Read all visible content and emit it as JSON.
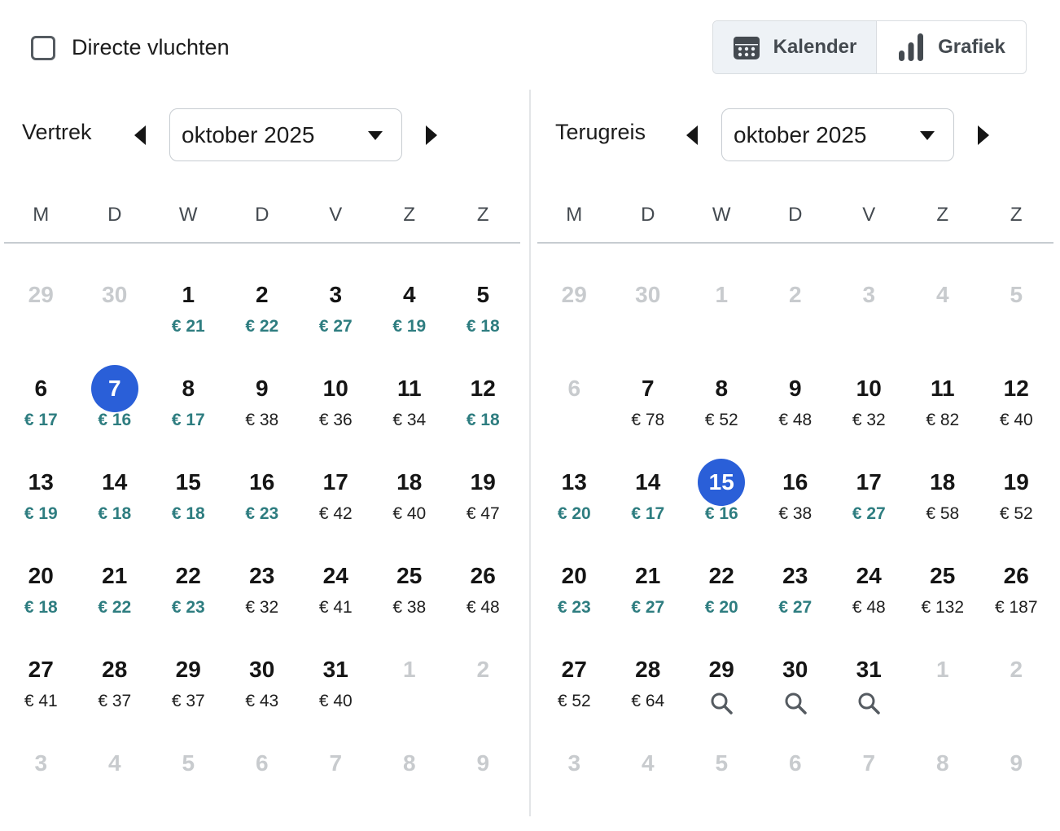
{
  "topbar": {
    "direct_label": "Directe vluchten",
    "view_toggle": {
      "calendar": "Kalender",
      "chart": "Grafiek"
    }
  },
  "weekdays": [
    "M",
    "D",
    "W",
    "D",
    "V",
    "Z",
    "Z"
  ],
  "colors": {
    "selected": "#2a5fd8",
    "cheap_price": "#2e7d80",
    "muted_day": "#c8cbce"
  },
  "panels": {
    "departure": {
      "label": "Vertrek",
      "month": "oktober 2025",
      "days": [
        {
          "d": "29",
          "muted": true
        },
        {
          "d": "30",
          "muted": true
        },
        {
          "d": "1",
          "p": "€ 21",
          "cheap": true
        },
        {
          "d": "2",
          "p": "€ 22",
          "cheap": true
        },
        {
          "d": "3",
          "p": "€ 27",
          "cheap": true
        },
        {
          "d": "4",
          "p": "€ 19",
          "cheap": true
        },
        {
          "d": "5",
          "p": "€ 18",
          "cheap": true
        },
        {
          "d": "6",
          "p": "€ 17",
          "cheap": true
        },
        {
          "d": "7",
          "p": "€ 16",
          "cheap": true,
          "selected": true
        },
        {
          "d": "8",
          "p": "€ 17",
          "cheap": true
        },
        {
          "d": "9",
          "p": "€ 38"
        },
        {
          "d": "10",
          "p": "€ 36"
        },
        {
          "d": "11",
          "p": "€ 34"
        },
        {
          "d": "12",
          "p": "€ 18",
          "cheap": true
        },
        {
          "d": "13",
          "p": "€ 19",
          "cheap": true
        },
        {
          "d": "14",
          "p": "€ 18",
          "cheap": true
        },
        {
          "d": "15",
          "p": "€ 18",
          "cheap": true
        },
        {
          "d": "16",
          "p": "€ 23",
          "cheap": true
        },
        {
          "d": "17",
          "p": "€ 42"
        },
        {
          "d": "18",
          "p": "€ 40"
        },
        {
          "d": "19",
          "p": "€ 47"
        },
        {
          "d": "20",
          "p": "€ 18",
          "cheap": true
        },
        {
          "d": "21",
          "p": "€ 22",
          "cheap": true
        },
        {
          "d": "22",
          "p": "€ 23",
          "cheap": true
        },
        {
          "d": "23",
          "p": "€ 32"
        },
        {
          "d": "24",
          "p": "€ 41"
        },
        {
          "d": "25",
          "p": "€ 38"
        },
        {
          "d": "26",
          "p": "€ 48"
        },
        {
          "d": "27",
          "p": "€ 41"
        },
        {
          "d": "28",
          "p": "€ 37"
        },
        {
          "d": "29",
          "p": "€ 37"
        },
        {
          "d": "30",
          "p": "€ 43"
        },
        {
          "d": "31",
          "p": "€ 40"
        },
        {
          "d": "1",
          "muted": true
        },
        {
          "d": "2",
          "muted": true
        },
        {
          "d": "3",
          "muted": true
        },
        {
          "d": "4",
          "muted": true
        },
        {
          "d": "5",
          "muted": true
        },
        {
          "d": "6",
          "muted": true
        },
        {
          "d": "7",
          "muted": true
        },
        {
          "d": "8",
          "muted": true
        },
        {
          "d": "9",
          "muted": true
        }
      ]
    },
    "return": {
      "label": "Terugreis",
      "month": "oktober 2025",
      "days": [
        {
          "d": "29",
          "muted": true
        },
        {
          "d": "30",
          "muted": true
        },
        {
          "d": "1",
          "muted": true
        },
        {
          "d": "2",
          "muted": true
        },
        {
          "d": "3",
          "muted": true
        },
        {
          "d": "4",
          "muted": true
        },
        {
          "d": "5",
          "muted": true
        },
        {
          "d": "6",
          "muted": true
        },
        {
          "d": "7",
          "p": "€ 78"
        },
        {
          "d": "8",
          "p": "€ 52"
        },
        {
          "d": "9",
          "p": "€ 48"
        },
        {
          "d": "10",
          "p": "€ 32"
        },
        {
          "d": "11",
          "p": "€ 82"
        },
        {
          "d": "12",
          "p": "€ 40"
        },
        {
          "d": "13",
          "p": "€ 20",
          "cheap": true
        },
        {
          "d": "14",
          "p": "€ 17",
          "cheap": true
        },
        {
          "d": "15",
          "p": "€ 16",
          "cheap": true,
          "selected": true
        },
        {
          "d": "16",
          "p": "€ 38"
        },
        {
          "d": "17",
          "p": "€ 27",
          "cheap": true
        },
        {
          "d": "18",
          "p": "€ 58"
        },
        {
          "d": "19",
          "p": "€ 52"
        },
        {
          "d": "20",
          "p": "€ 23",
          "cheap": true
        },
        {
          "d": "21",
          "p": "€ 27",
          "cheap": true
        },
        {
          "d": "22",
          "p": "€ 20",
          "cheap": true
        },
        {
          "d": "23",
          "p": "€ 27",
          "cheap": true
        },
        {
          "d": "24",
          "p": "€ 48"
        },
        {
          "d": "25",
          "p": "€ 132"
        },
        {
          "d": "26",
          "p": "€ 187"
        },
        {
          "d": "27",
          "p": "€ 52"
        },
        {
          "d": "28",
          "p": "€ 64"
        },
        {
          "d": "29",
          "search": true
        },
        {
          "d": "30",
          "search": true
        },
        {
          "d": "31",
          "search": true
        },
        {
          "d": "1",
          "muted": true
        },
        {
          "d": "2",
          "muted": true
        },
        {
          "d": "3",
          "muted": true
        },
        {
          "d": "4",
          "muted": true
        },
        {
          "d": "5",
          "muted": true
        },
        {
          "d": "6",
          "muted": true
        },
        {
          "d": "7",
          "muted": true
        },
        {
          "d": "8",
          "muted": true
        },
        {
          "d": "9",
          "muted": true
        }
      ]
    }
  }
}
